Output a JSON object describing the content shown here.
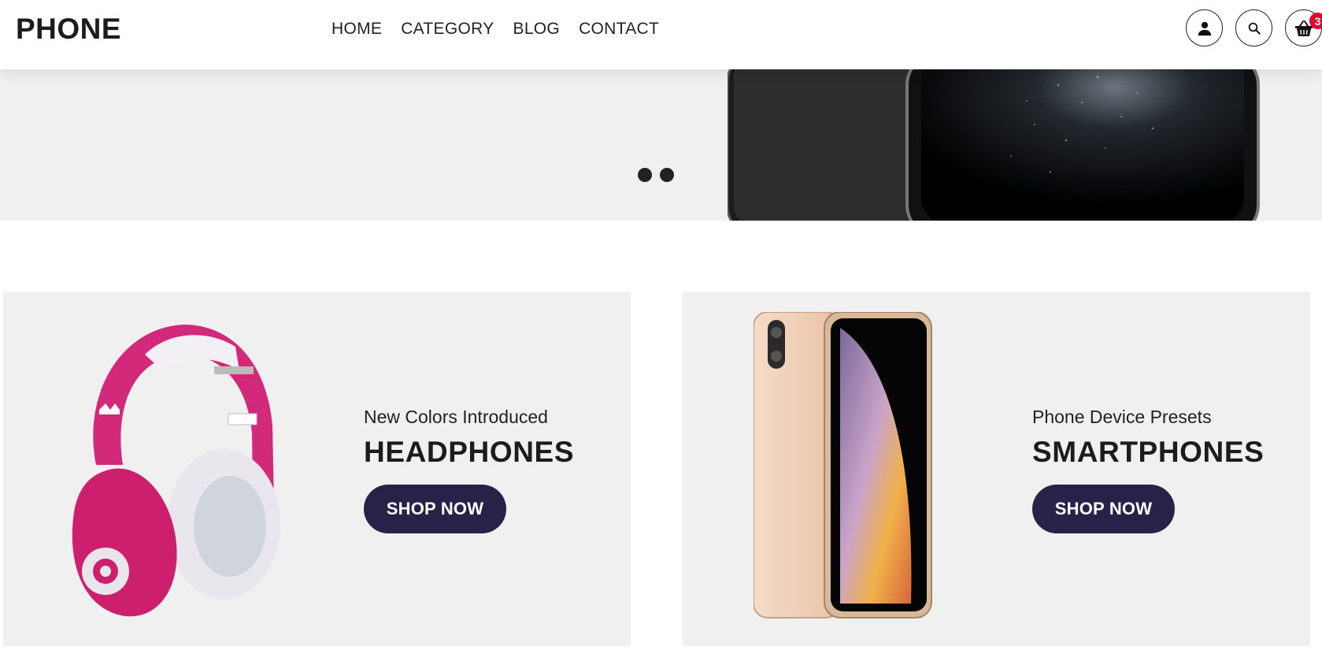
{
  "brand": {
    "logo_text": "PHONE"
  },
  "nav": {
    "items": [
      {
        "label": "HOME"
      },
      {
        "label": "CATEGORY"
      },
      {
        "label": "BLOG"
      },
      {
        "label": "CONTACT"
      }
    ]
  },
  "header_icons": {
    "account": "user-icon",
    "search": "search-icon",
    "cart": "basket-icon",
    "cart_count": "3"
  },
  "hero": {
    "slide_count": 2
  },
  "promos": [
    {
      "subtitle": "New Colors Introduced",
      "title": "HEADPHONES",
      "button_label": "SHOP NOW",
      "image": "pink-headphones-image"
    },
    {
      "subtitle": "Phone Device Presets",
      "title": "SMARTPHONES",
      "button_label": "SHOP NOW",
      "image": "gold-smartphone-image"
    }
  ],
  "colors": {
    "button_bg": "#2a2148",
    "badge": "#e8002d",
    "panel_bg": "#f0f0f0"
  }
}
